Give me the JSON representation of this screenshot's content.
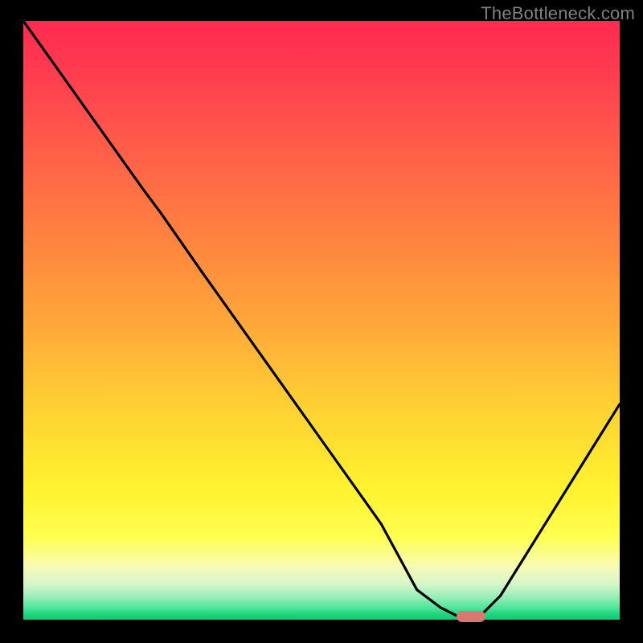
{
  "watermark": "TheBottleneck.com",
  "colors": {
    "frame": "#000000",
    "gradient_top": "#ff2a4f",
    "gradient_bottom": "#0fc872",
    "curve": "#000000",
    "marker": "#d9786f",
    "watermark_text": "#808080"
  },
  "chart_data": {
    "type": "line",
    "title": "",
    "xlabel": "",
    "ylabel": "",
    "xlim": [
      0,
      100
    ],
    "ylim": [
      0,
      100
    ],
    "grid": false,
    "legend": false,
    "series": [
      {
        "name": "bottleneck-curve",
        "x": [
          0,
          5,
          10,
          15,
          20,
          23,
          30,
          40,
          50,
          60,
          66,
          70,
          74,
          76,
          80,
          85,
          90,
          95,
          100
        ],
        "y": [
          100,
          93,
          86,
          79,
          72,
          68,
          58,
          44,
          30,
          16,
          5,
          2,
          0,
          0,
          4,
          12,
          20,
          28,
          36
        ]
      }
    ],
    "marker": {
      "x_center": 75,
      "y": 0,
      "width_pct": 5
    }
  }
}
